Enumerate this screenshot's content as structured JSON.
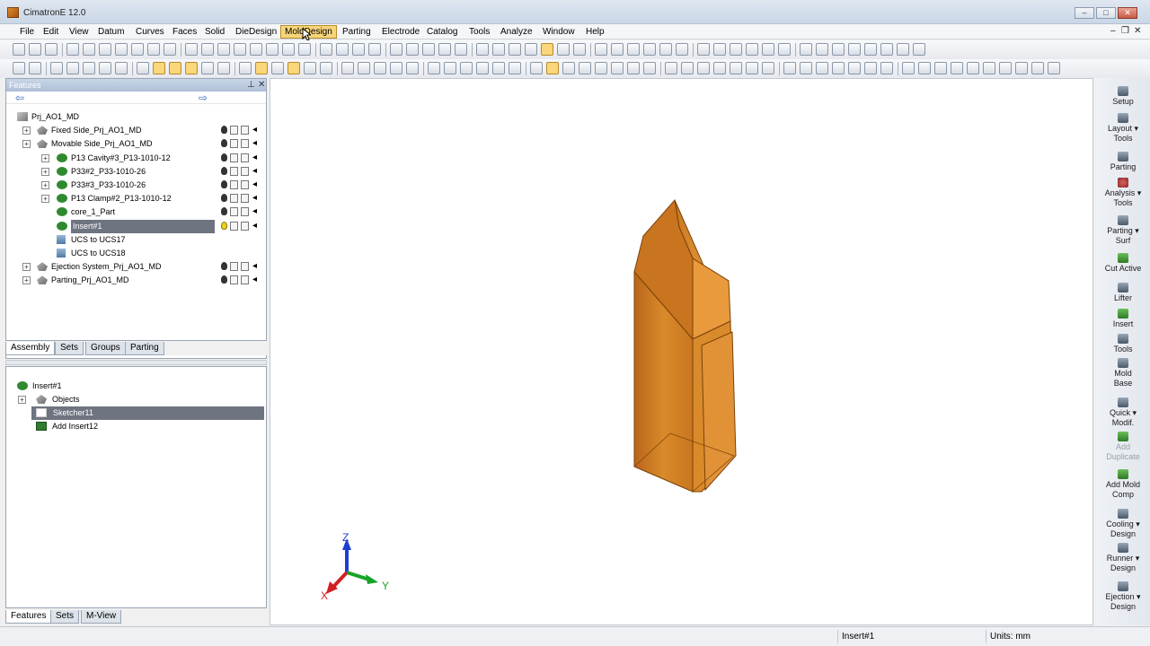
{
  "window": {
    "title": "CimatronE 12.0",
    "minimize": "–",
    "maximize": "□",
    "close": "✕"
  },
  "menus": [
    "File",
    "Edit",
    "View",
    "Datum",
    "Curves",
    "Faces",
    "Solid",
    "DieDesign",
    "MoldDesign",
    "Parting",
    "Electrode",
    "Catalog",
    "Tools",
    "Analyze",
    "Window",
    "Help"
  ],
  "active_menu": "MoldDesign",
  "mdi": {
    "minimize": "–",
    "restore": "❐",
    "close": "✕"
  },
  "features_panel": {
    "title": "Features",
    "pin": "⊥",
    "close": "✕",
    "back": "⇦",
    "forward": "⇨",
    "tree": [
      {
        "label": "Prj_AO1_MD"
      },
      {
        "label": "Fixed Side_Prj_AO1_MD"
      },
      {
        "label": "Movable Side_Prj_AO1_MD"
      },
      {
        "label": "P13 Cavity#3_P13-1010-12"
      },
      {
        "label": "P33#2_P33-1010-26"
      },
      {
        "label": "P33#3_P33-1010-26"
      },
      {
        "label": "P13 Clamp#2_P13-1010-12"
      },
      {
        "label": "core_1_Part"
      },
      {
        "label": "Insert#1"
      },
      {
        "label": "UCS to UCS17"
      },
      {
        "label": "UCS to UCS18"
      },
      {
        "label": "Ejection System_Prj_AO1_MD"
      },
      {
        "label": "Parting_Prj_AO1_MD"
      }
    ],
    "tabs": [
      "Assembly",
      "Sets",
      "Groups",
      "Parting"
    ]
  },
  "params_panel": {
    "tree": [
      {
        "label": "Insert#1"
      },
      {
        "label": "Objects"
      },
      {
        "label": "Sketcher11"
      },
      {
        "label": "Add Insert12"
      }
    ]
  },
  "bottom_tabs": [
    "Features",
    "Sets",
    "M-View"
  ],
  "triad": {
    "x": "X",
    "y": "Y",
    "z": "Z"
  },
  "right_toolbar": [
    {
      "label": "Setup",
      "icon": "setup-icon"
    },
    {
      "label": "Layout ▾\nTools",
      "icon": "layout-tools-icon"
    },
    {
      "label": "Parting",
      "icon": "parting-icon"
    },
    {
      "label": "Analysis ▾\nTools",
      "icon": "analysis-tools-icon"
    },
    {
      "label": "Parting ▾\nSurf",
      "icon": "parting-surf-icon"
    },
    {
      "label": "Cut Active",
      "icon": "cut-active-icon"
    },
    {
      "label": "Lifter",
      "icon": "lifter-icon"
    },
    {
      "label": "Insert",
      "icon": "insert-icon"
    },
    {
      "label": "Tools",
      "icon": "tools-icon"
    },
    {
      "label": "Mold\nBase",
      "icon": "mold-base-icon"
    },
    {
      "label": "Quick ▾\nModif.",
      "icon": "quick-modif-icon"
    },
    {
      "label": "Add\nDuplicate",
      "icon": "add-duplicate-icon"
    },
    {
      "label": "Add Mold\nComp",
      "icon": "add-mold-comp-icon"
    },
    {
      "label": "Cooling ▾\nDesign",
      "icon": "cooling-design-icon"
    },
    {
      "label": "Runner ▾\nDesign",
      "icon": "runner-design-icon"
    },
    {
      "label": "Ejection ▾\nDesign",
      "icon": "ejection-design-icon"
    }
  ],
  "status": {
    "selection": "Insert#1",
    "units": "Units: mm"
  },
  "colors": {
    "accent": "#f7d57a",
    "part_orange": "#d98a2a",
    "tree_selection": "#6e7480"
  }
}
